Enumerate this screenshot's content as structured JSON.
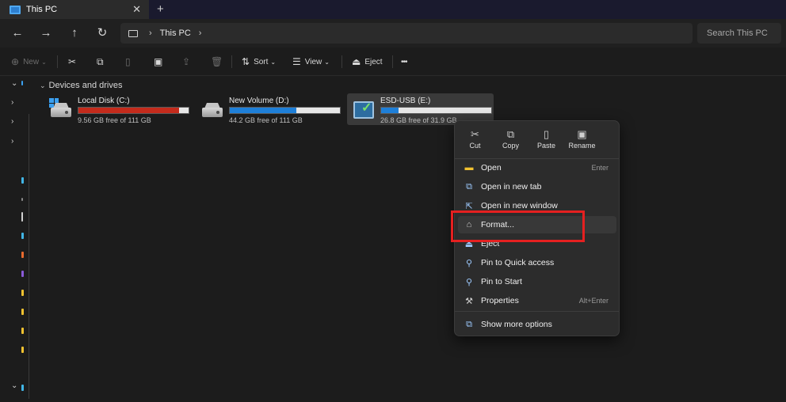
{
  "window": {
    "tab_title": "This PC",
    "close_glyph": "✕",
    "new_tab_glyph": "+"
  },
  "nav": {
    "back": "←",
    "forward": "→",
    "up": "↑",
    "refresh": "↻",
    "breadcrumb": [
      "This PC"
    ],
    "chevron": "›",
    "search_placeholder": "Search This PC"
  },
  "toolbar": {
    "new_label": "New",
    "sort_label": "Sort",
    "view_label": "View",
    "eject_label": "Eject",
    "more_glyph": "•••"
  },
  "content": {
    "section_title": "Devices and drives",
    "drives": [
      {
        "name": "Local Disk (C:)",
        "free_text": "9.56 GB free of 111 GB",
        "used_fraction": 0.914,
        "bar_color": "#c42b1c"
      },
      {
        "name": "New Volume (D:)",
        "free_text": "44.2 GB free of 111 GB",
        "used_fraction": 0.602,
        "bar_color": "#1e7fd8"
      },
      {
        "name": "ESD-USB (E:)",
        "free_text": "26.8 GB free of 31.9 GB",
        "used_fraction": 0.16,
        "bar_color": "#1e7fd8"
      }
    ]
  },
  "context_menu": {
    "quick_actions": [
      {
        "label": "Cut",
        "icon": "scissors-icon"
      },
      {
        "label": "Copy",
        "icon": "copy-icon"
      },
      {
        "label": "Paste",
        "icon": "paste-icon"
      },
      {
        "label": "Rename",
        "icon": "rename-icon"
      }
    ],
    "items": [
      {
        "label": "Open",
        "accel": "Enter",
        "icon": "folder-open-icon"
      },
      {
        "label": "Open in new tab",
        "accel": "",
        "icon": "new-tab-icon"
      },
      {
        "label": "Open in new window",
        "accel": "",
        "icon": "new-window-icon"
      },
      {
        "label": "Format...",
        "accel": "",
        "icon": "format-icon"
      },
      {
        "label": "Eject",
        "accel": "",
        "icon": "eject-icon"
      },
      {
        "label": "Pin to Quick access",
        "accel": "",
        "icon": "pin-icon"
      },
      {
        "label": "Pin to Start",
        "accel": "",
        "icon": "pin-start-icon"
      },
      {
        "label": "Properties",
        "accel": "Alt+Enter",
        "icon": "wrench-icon"
      },
      {
        "label": "Show more options",
        "accel": "",
        "icon": "more-options-icon"
      }
    ]
  },
  "colors": {
    "highlight_box": "#e52020",
    "accent": "#1e7fd8"
  }
}
